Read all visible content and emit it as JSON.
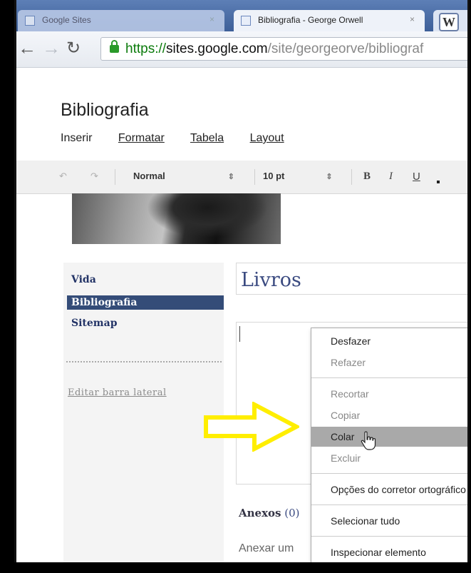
{
  "browser": {
    "tabs": [
      {
        "label": "Google Sites",
        "active": false
      },
      {
        "label": "Bibliografia - George Orwell",
        "active": true
      },
      {
        "label": "W",
        "active": false
      }
    ],
    "close_glyph": "×",
    "url": {
      "scheme": "https://",
      "host": "sites.google.com",
      "path": "/site/georgeorve/bibliograf"
    },
    "icons": {
      "back": "back-arrow-icon",
      "forward": "forward-arrow-icon",
      "reload": "reload-icon",
      "lock": "lock-icon"
    }
  },
  "editor": {
    "doc_title": "Bibliografia",
    "menu": [
      "Inserir",
      "Formatar",
      "Tabela",
      "Layout"
    ],
    "toolbar": {
      "style_value": "Normal",
      "size_value": "10 pt",
      "bold": "B",
      "italic": "I",
      "underline": "U"
    }
  },
  "sidebar": {
    "items": [
      {
        "label": "Vida",
        "active": false
      },
      {
        "label": "Bibliografia",
        "active": true
      },
      {
        "label": "Sitemap",
        "active": false
      }
    ],
    "edit_link": "Editar barra lateral"
  },
  "page": {
    "heading": "Livros",
    "attachments_label": "Anexos",
    "attachments_count": "(0)",
    "attach_link": "Anexar um"
  },
  "context_menu": {
    "items": [
      {
        "label": "Desfazer",
        "disabled": false
      },
      {
        "label": "Refazer",
        "disabled": true
      },
      {
        "label": "Recortar",
        "disabled": true
      },
      {
        "label": "Copiar",
        "disabled": true
      },
      {
        "label": "Colar",
        "disabled": false,
        "highlighted": true
      },
      {
        "label": "Excluir",
        "disabled": true
      },
      {
        "label": "Opções do corretor ortográfico",
        "disabled": false
      },
      {
        "label": "Selecionar tudo",
        "disabled": false
      },
      {
        "label": "Inspecionar elemento",
        "disabled": false
      }
    ]
  },
  "colors": {
    "annotation_arrow": "#ffee00",
    "sidebar_active": "#344c78",
    "url_scheme": "#0b7b0b"
  }
}
